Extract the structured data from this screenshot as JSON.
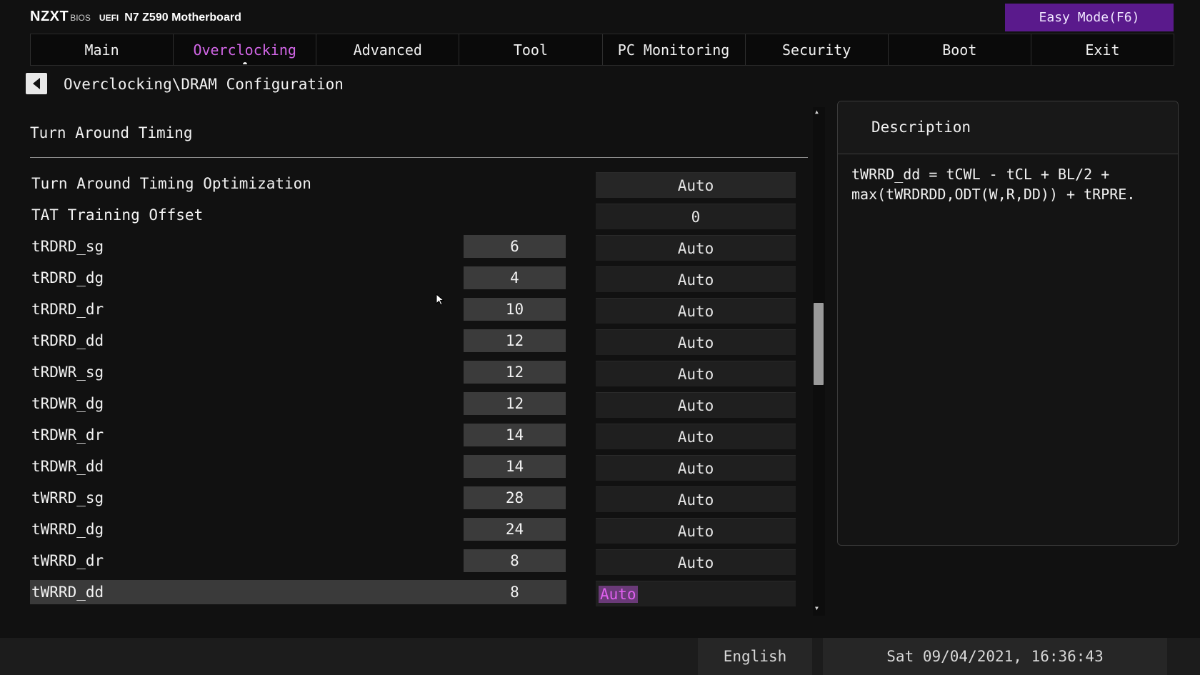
{
  "header": {
    "logo": "NZXT",
    "bios": "BIOS",
    "uefi": "UEFI",
    "model": "N7 Z590 Motherboard",
    "easy_mode_label": "Easy Mode(F6)",
    "accent_color": "#5a1a8c"
  },
  "tabs": [
    {
      "label": "Main"
    },
    {
      "label": "Overclocking",
      "active": true
    },
    {
      "label": "Advanced"
    },
    {
      "label": "Tool"
    },
    {
      "label": "PC Monitoring"
    },
    {
      "label": "Security"
    },
    {
      "label": "Boot"
    },
    {
      "label": "Exit"
    }
  ],
  "breadcrumb": "Overclocking\\DRAM Configuration",
  "back_icon": "arrow-left-icon",
  "section": {
    "title": "Turn Around Timing"
  },
  "rows": [
    {
      "label": "Turn Around Timing Optimization",
      "current": "",
      "setting": "Auto"
    },
    {
      "label": "TAT Training Offset",
      "current": "",
      "setting": "0"
    },
    {
      "label": "tRDRD_sg",
      "current": "6",
      "setting": "Auto"
    },
    {
      "label": "tRDRD_dg",
      "current": "4",
      "setting": "Auto"
    },
    {
      "label": "tRDRD_dr",
      "current": "10",
      "setting": "Auto"
    },
    {
      "label": "tRDRD_dd",
      "current": "12",
      "setting": "Auto"
    },
    {
      "label": "tRDWR_sg",
      "current": "12",
      "setting": "Auto"
    },
    {
      "label": "tRDWR_dg",
      "current": "12",
      "setting": "Auto"
    },
    {
      "label": "tRDWR_dr",
      "current": "14",
      "setting": "Auto"
    },
    {
      "label": "tRDWR_dd",
      "current": "14",
      "setting": "Auto"
    },
    {
      "label": "tWRRD_sg",
      "current": "28",
      "setting": "Auto"
    },
    {
      "label": "tWRRD_dg",
      "current": "24",
      "setting": "Auto"
    },
    {
      "label": "tWRRD_dr",
      "current": "8",
      "setting": "Auto"
    },
    {
      "label": "tWRRD_dd",
      "current": "8",
      "setting": "Auto",
      "selected": true
    }
  ],
  "description": {
    "title": "Description",
    "text": "tWRRD_dd = tCWL - tCL + BL/2 +\nmax(tWRDRDD,ODT(W,R,DD)) + tRPRE."
  },
  "footer": {
    "language": "English",
    "datetime": "Sat 09/04/2021, 16:36:43"
  }
}
